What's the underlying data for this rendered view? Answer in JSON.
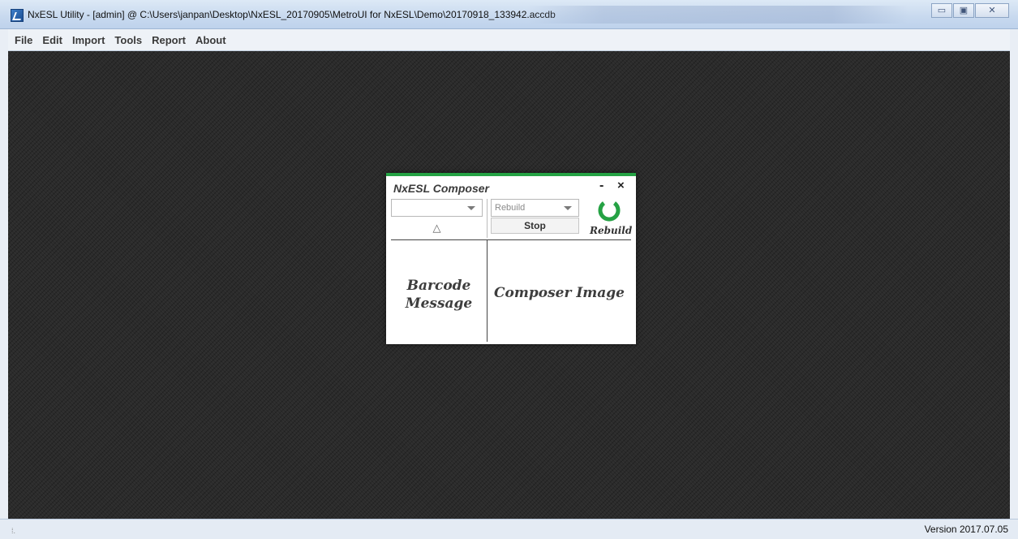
{
  "window": {
    "title": "NxESL Utility - [admin] @ C:\\Users\\janpan\\Desktop\\NxESL_20170905\\MetroUI for NxESL\\Demo\\20170918_133942.accdb",
    "minimize_glyph": "▭",
    "maximize_glyph": "▣",
    "close_glyph": "✕"
  },
  "menu": [
    {
      "label": "File"
    },
    {
      "label": "Edit"
    },
    {
      "label": "Import"
    },
    {
      "label": "Tools"
    },
    {
      "label": "Report"
    },
    {
      "label": "About"
    }
  ],
  "composer": {
    "title": "NxESL Composer",
    "minimize_glyph": "-",
    "close_glyph": "×",
    "left_select_value": "",
    "right_select_value": "Rebuild",
    "sort_glyph": "△",
    "stop_label": "Stop",
    "rebuild_label": "Rebuild",
    "rebuild_icon": "refresh-icon",
    "accent_color": "#25a244",
    "barcode_line1": "Barcode",
    "barcode_line2": "Message",
    "composer_image_label": "Composer Image"
  },
  "status": {
    "grip": "⁞.",
    "version": "Version 2017.07.05"
  }
}
